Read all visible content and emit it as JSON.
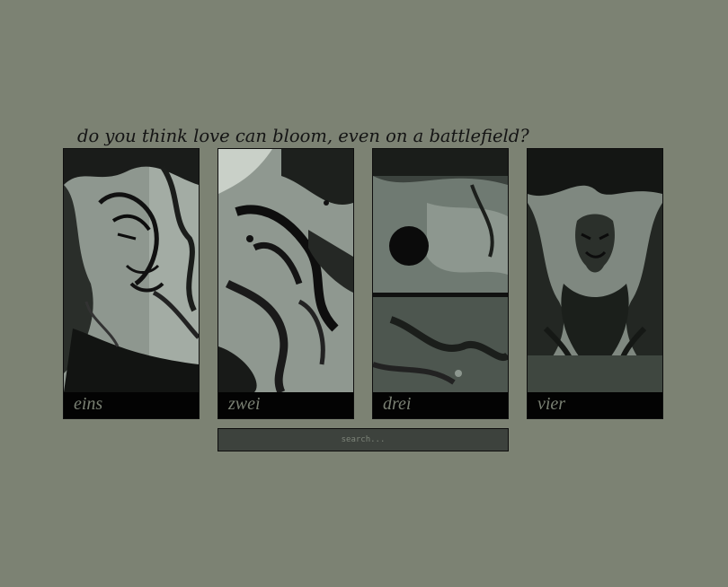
{
  "tagline": "do you think love can bloom, even on a battlefield?",
  "panels": [
    {
      "label": "eins"
    },
    {
      "label": "zwei"
    },
    {
      "label": "drei"
    },
    {
      "label": "vier"
    }
  ],
  "search": {
    "placeholder": "search...",
    "value": ""
  },
  "colors": {
    "background": "#7c8273",
    "caption_bar": "#030303",
    "caption_text": "#7a8073",
    "search_bg": "#3d423d",
    "art_tone": "#9aa39a"
  }
}
